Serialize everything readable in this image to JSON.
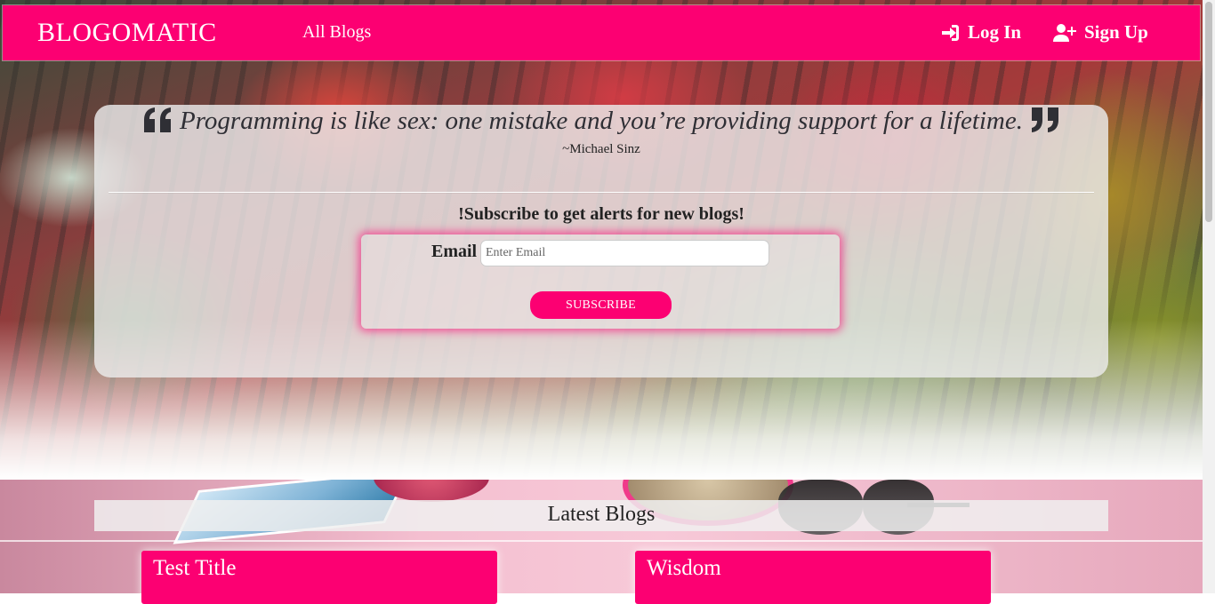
{
  "navbar": {
    "brand": "BLOGOMATIC",
    "all_blogs": "All Blogs",
    "login": "Log In",
    "signup": "Sign Up",
    "accent_color": "#fc0072"
  },
  "quote": {
    "text": "Programming is like sex: one mistake and you’re providing support for a lifetime.",
    "author": "~Michael Sinz"
  },
  "subscribe": {
    "heading": "!Subscribe to get alerts for new blogs!",
    "email_label": "Email",
    "email_placeholder": "Enter Email",
    "button_label": "SUBSCRIBE"
  },
  "latest": {
    "heading": "Latest Blogs",
    "cards": [
      {
        "title": "Test Title"
      },
      {
        "title": "Wisdom"
      }
    ]
  },
  "icons": {
    "login": "sign-in-icon",
    "signup": "user-plus-icon",
    "quote_open": "quote-left-icon",
    "quote_close": "quote-right-icon"
  }
}
